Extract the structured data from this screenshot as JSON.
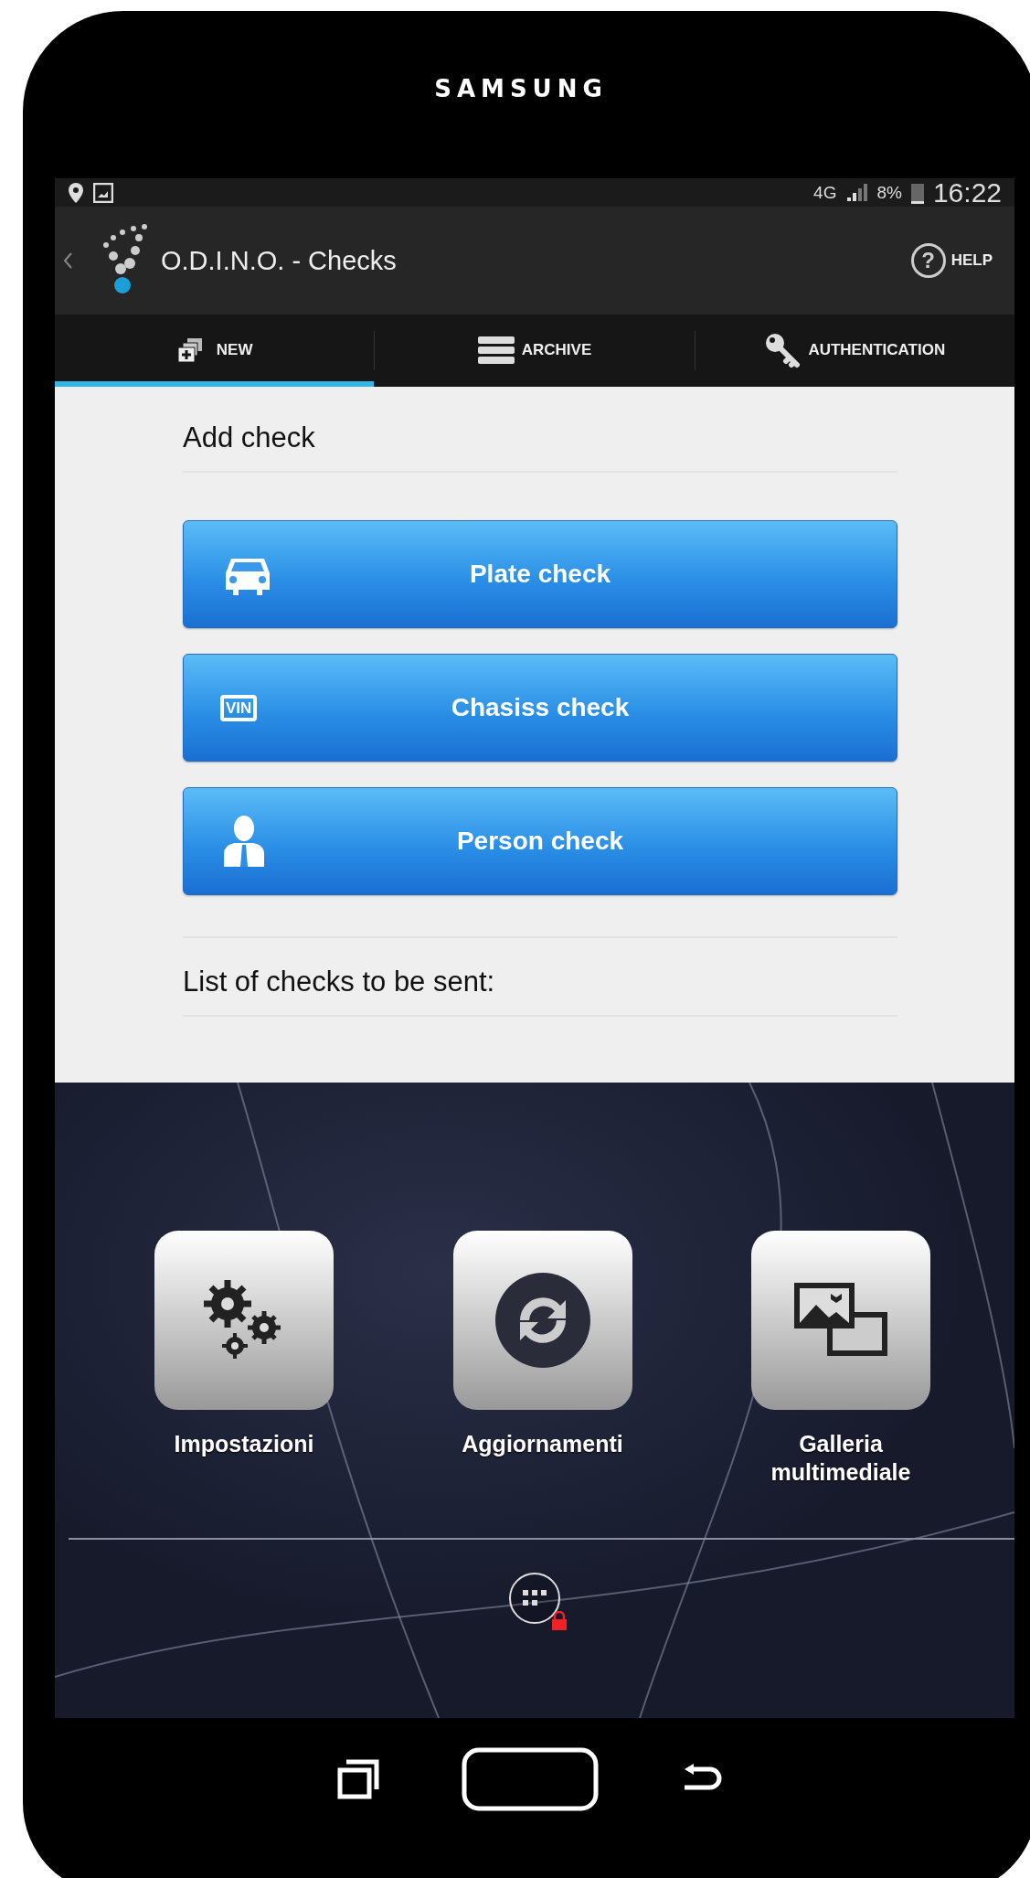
{
  "device": {
    "brand": "SAMSUNG"
  },
  "status_bar": {
    "network": "4G",
    "battery": "8%",
    "time": "16:22"
  },
  "app_bar": {
    "title": "O.D.I.N.O. - Checks",
    "help": "HELP",
    "help_glyph": "?"
  },
  "tabs": [
    {
      "label": "NEW",
      "kind": "new",
      "selected": true
    },
    {
      "label": "ARCHIVE",
      "kind": "archive",
      "selected": false
    },
    {
      "label": "AUTHENTICATION",
      "kind": "key",
      "selected": false
    }
  ],
  "add_check": {
    "title": "Add check",
    "buttons": [
      {
        "label": "Plate check",
        "kind": "car"
      },
      {
        "label": "Chasiss check",
        "kind": "vin",
        "badge": "VIN"
      },
      {
        "label": "Person check",
        "kind": "person"
      }
    ]
  },
  "list": {
    "title": "List of checks to be sent:"
  },
  "home_shortcuts": [
    {
      "label": "Impostazioni",
      "kind": "gears"
    },
    {
      "label": "Aggiornamenti",
      "kind": "sync"
    },
    {
      "label": "Galleria multimediale",
      "kind": "gallery"
    }
  ]
}
